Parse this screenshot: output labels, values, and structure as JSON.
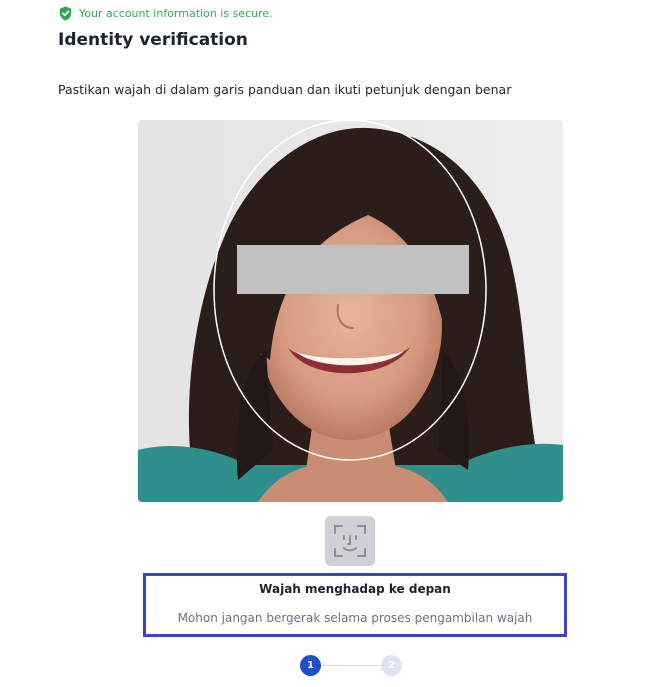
{
  "secure_banner": {
    "text": "Your account information is secure.",
    "icon": "shield-check-icon",
    "color": "#3aa45a"
  },
  "header": {
    "title": "Identity verification"
  },
  "instruction": "Pastikan wajah di dalam garis panduan dan ikuti petunjuk dengan benar",
  "camera": {
    "guide": "face-oval-guide",
    "redaction": "face-redaction-bar"
  },
  "face_id_icon": "face-id-icon",
  "status": {
    "title": "Wajah menghadap ke depan",
    "subtitle": "Mohon jangan bergerak selama proses pengambilan wajah",
    "border_color": "#3c42c9"
  },
  "stepper": {
    "steps": [
      {
        "label": "1",
        "state": "active"
      },
      {
        "label": "2",
        "state": "inactive"
      }
    ],
    "active_color": "#1f4fc9"
  }
}
